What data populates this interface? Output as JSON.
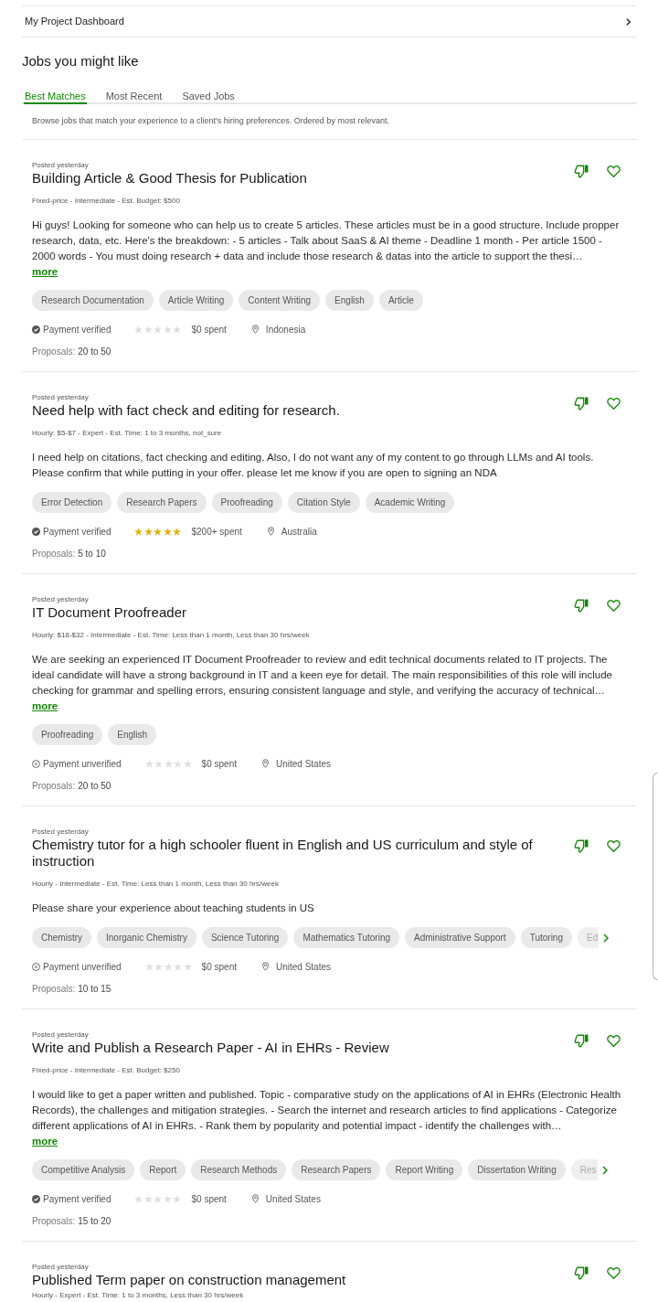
{
  "top_link": {
    "label": "My Project Dashboard"
  },
  "section_title": "Jobs you might like",
  "tabs": [
    {
      "label": "Best Matches",
      "selected": true
    },
    {
      "label": "Most Recent",
      "selected": false
    },
    {
      "label": "Saved Jobs",
      "selected": false
    }
  ],
  "tab_description": "Browse jobs that match your experience to a client's hiring preferences. Ordered by most relevant.",
  "jobs": [
    {
      "posted": "Posted yesterday",
      "title": "Building Article & Good Thesis for Publication",
      "meta": "Fixed-price - Intermediate - Est. Budget: $500",
      "description": "Hi guys! Looking for someone who can help us to create 5 articles. These articles must be in a good structure. Include propper research, data, etc. Here's the breakdown: - 5 articles - Talk about SaaS & AI theme - Deadline 1 month - Per article 1500 - 2000 words - You must doing research + data and include those research & datas into the article to support the thesi…",
      "more": "more",
      "skills": [
        "Research Documentation",
        "Article Writing",
        "Content Writing",
        "English",
        "Article"
      ],
      "scroll_more": false,
      "payment": {
        "verified": true,
        "label": "Payment verified"
      },
      "stars": 0,
      "spent": "$0 spent",
      "location": "Indonesia",
      "proposals_label": "Proposals:",
      "proposals": "20 to 50"
    },
    {
      "posted": "Posted yesterday",
      "title": "Need help with fact check and editing for research.",
      "meta": "Hourly: $5-$7 - Expert - Est. Time: 1 to 3 months, not_sure",
      "description": "I need help on citations, fact checking and editing. Also, I do not want any of my content to go through LLMs and AI tools. Please confirm that while putting in your offer. please let me know if you are open to signing an NDA",
      "skills": [
        "Error Detection",
        "Research Papers",
        "Proofreading",
        "Citation Style",
        "Academic Writing"
      ],
      "scroll_more": false,
      "payment": {
        "verified": true,
        "label": "Payment verified"
      },
      "stars": 5,
      "spent": "$200+ spent",
      "location": "Australia",
      "proposals_label": "Proposals:",
      "proposals": "5 to 10"
    },
    {
      "posted": "Posted yesterday",
      "title": "IT Document Proofreader",
      "meta": "Hourly: $18-$32 - Intermediate - Est. Time: Less than 1 month, Less than 30 hrs/week",
      "description": "We are seeking an experienced IT Document Proofreader to review and edit technical documents related to IT projects. The ideal candidate will have a strong background in IT and a keen eye for detail. The main responsibilities of this role will include checking for grammar and spelling errors, ensuring consistent language and style, and verifying the accuracy of technical…",
      "more": "more",
      "skills": [
        "Proofreading",
        "English"
      ],
      "scroll_more": false,
      "payment": {
        "verified": false,
        "label": "Payment unverified"
      },
      "stars": 0,
      "spent": "$0 spent",
      "location": "United States",
      "proposals_label": "Proposals:",
      "proposals": "20 to 50"
    },
    {
      "posted": "Posted yesterday",
      "title": "Chemistry tutor for a high schooler fluent in English and US curriculum and style of instruction",
      "meta": "Hourly - Intermediate - Est. Time: Less than 1 month, Less than 30 hrs/week",
      "description": "Please share your experience about teaching students in US",
      "skills": [
        "Chemistry",
        "Inorganic Chemistry",
        "Science Tutoring",
        "Mathematics Tutoring",
        "Administrative Support",
        "Tutoring"
      ],
      "partial_skill": "Ed",
      "scroll_more": true,
      "payment": {
        "verified": false,
        "label": "Payment unverified"
      },
      "stars": 0,
      "spent": "$0 spent",
      "location": "United States",
      "proposals_label": "Proposals:",
      "proposals": "10 to 15"
    },
    {
      "posted": "Posted yesterday",
      "title": "Write and Publish a Research Paper - AI in EHRs - Review",
      "meta": "Fixed-price - Intermediate - Est. Budget: $250",
      "description": "I would like to get a paper written and published. Topic - comparative study on the applications of AI in EHRs (Electronic Health Records), the challenges and mitigation strategies. - Search the internet and research articles to find applications - Categorize different applications of AI in EHRs. - Rank them by popularity and potential impact - identify the challenges with…",
      "more": "more",
      "skills": [
        "Competitive Analysis",
        "Report",
        "Research Methods",
        "Research Papers",
        "Report Writing",
        "Dissertation Writing"
      ],
      "partial_skill": "Res",
      "scroll_more": true,
      "payment": {
        "verified": true,
        "label": "Payment verified"
      },
      "stars": 0,
      "spent": "$0 spent",
      "location": "United States",
      "proposals_label": "Proposals:",
      "proposals": "15 to 20"
    },
    {
      "posted": "Posted yesterday",
      "title": "Published Term paper on construction management",
      "meta": "Hourly - Expert - Est. Time: 1 to 3 months, Less than 30 hrs/week"
    }
  ]
}
